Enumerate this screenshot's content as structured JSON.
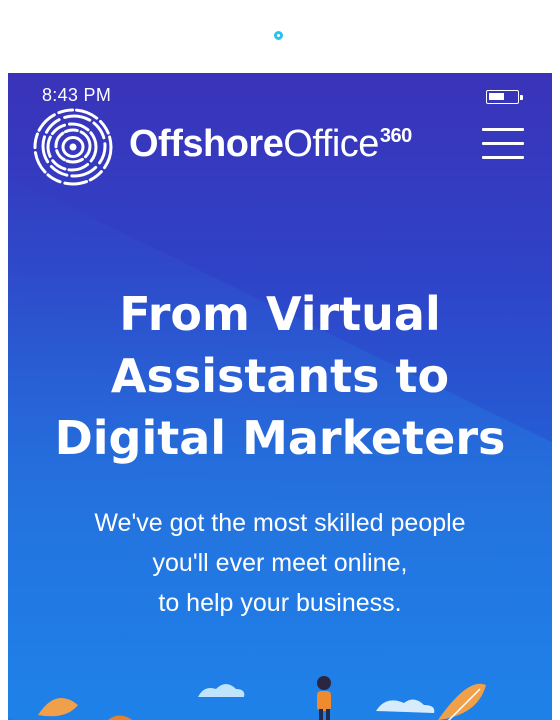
{
  "status_bar": {
    "time": "8:43 PM"
  },
  "brand": {
    "name_bold": "Offshore",
    "name_light": "Office",
    "name_sup": "360"
  },
  "header": {
    "menu_icon": "hamburger-menu-icon"
  },
  "hero": {
    "title_lines": [
      "From Virtual",
      "Assistants to",
      "Digital Marketers"
    ],
    "subtitle_lines": [
      "We've got the most skilled people",
      "you'll ever meet online,",
      "to help your business."
    ]
  },
  "colors": {
    "background_top": "#3a33b9",
    "background_bottom": "#1c79e6",
    "loader_dot": "#29c4ee",
    "text": "#ffffff"
  }
}
